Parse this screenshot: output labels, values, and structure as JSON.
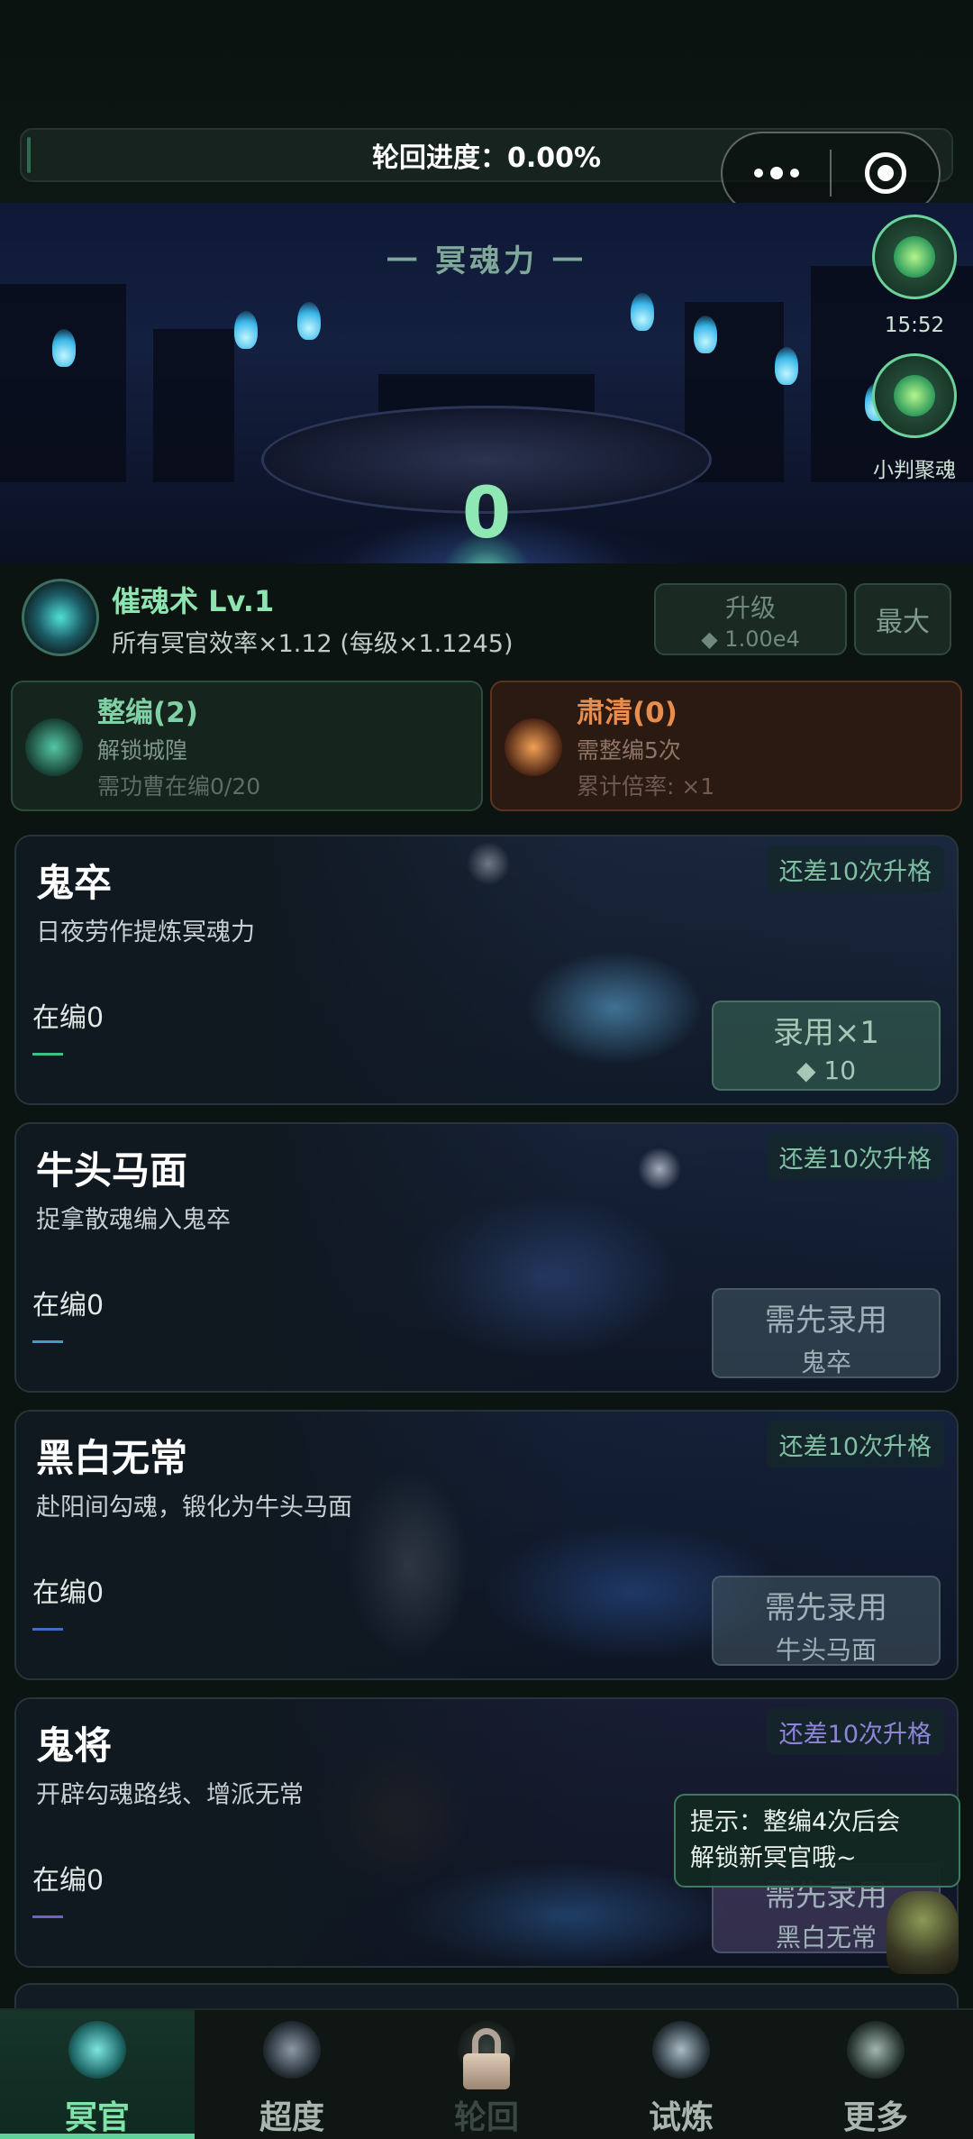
{
  "header": {
    "progress_label": "轮回进度：0.00%"
  },
  "hero": {
    "title": "一 冥魂力 一",
    "value": "0"
  },
  "side_buttons": {
    "timer": "15:52",
    "gather_label": "小判聚魂"
  },
  "skill": {
    "name": "催魂术 Lv.1",
    "desc": "所有冥官效率×1.12 (每级×1.1245)",
    "upgrade_label": "升级",
    "upgrade_cost": "◆ 1.00e4",
    "max_label": "最大"
  },
  "panels": {
    "reorganize": {
      "title": "整编(2)",
      "line1": "解锁城隍",
      "line2": "需功曹在编0/20"
    },
    "purge": {
      "title": "肃清(0)",
      "line1": "需整编5次",
      "line2": "累计倍率: ×1"
    }
  },
  "cards": [
    {
      "name": "鬼卒",
      "desc": "日夜劳作提炼冥魂力",
      "count": "在编0",
      "tag": "还差10次升格",
      "action": "录用×1",
      "action_sub": "◆ 10"
    },
    {
      "name": "牛头马面",
      "desc": "捉拿散魂编入鬼卒",
      "count": "在编0",
      "tag": "还差10次升格",
      "action": "需先录用",
      "action_sub": "鬼卒"
    },
    {
      "name": "黑白无常",
      "desc": "赴阳间勾魂，锻化为牛头马面",
      "count": "在编0",
      "tag": "还差10次升格",
      "action": "需先录用",
      "action_sub": "牛头马面"
    },
    {
      "name": "鬼将",
      "desc": "开辟勾魂路线、增派无常",
      "count": "在编0",
      "tag": "还差10次升格",
      "action": "需先录用",
      "action_sub": "黑白无常"
    }
  ],
  "tooltip": {
    "line1": "提示：整编4次后会",
    "line2": "解锁新冥官哦~"
  },
  "nav": {
    "items": [
      {
        "label": "冥官",
        "icon": "ghost-official-icon"
      },
      {
        "label": "超度",
        "icon": "lantern-shrine-icon"
      },
      {
        "label": "轮回",
        "icon": "lock-icon"
      },
      {
        "label": "试炼",
        "icon": "flame-trial-icon"
      },
      {
        "label": "更多",
        "icon": "more-spirit-icon"
      }
    ],
    "active": "冥官"
  },
  "colors": {
    "accent": "#8fe8b4",
    "orange": "#e98d4c",
    "background": "#0b1411"
  }
}
